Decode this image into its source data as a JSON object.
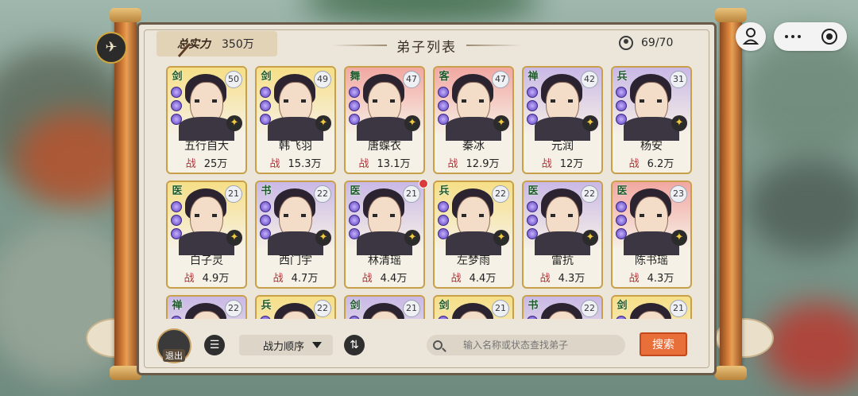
{
  "header": {
    "total_power_label": "总实力",
    "total_power_value": "350万",
    "title": "弟子列表",
    "disciple_count": "69/70"
  },
  "power_prefix": "战",
  "disciples": [
    {
      "type": "剑",
      "level": "50",
      "name": "五行自大",
      "power": "25万",
      "color": "#f6df86"
    },
    {
      "type": "剑",
      "level": "49",
      "name": "韩飞羽",
      "power": "15.3万",
      "color": "#f6df86"
    },
    {
      "type": "舞",
      "level": "47",
      "name": "唐蝶衣",
      "power": "13.1万",
      "color": "#f2a7a2"
    },
    {
      "type": "客",
      "level": "47",
      "name": "秦冰",
      "power": "12.9万",
      "color": "#f2a7a2"
    },
    {
      "type": "禅",
      "level": "42",
      "name": "元润",
      "power": "12万",
      "color": "#c9b8e6"
    },
    {
      "type": "兵",
      "level": "31",
      "name": "杨安",
      "power": "6.2万",
      "color": "#c9b8e6"
    },
    {
      "type": "医",
      "level": "21",
      "name": "白子灵",
      "power": "4.9万",
      "color": "#f6df86"
    },
    {
      "type": "书",
      "level": "22",
      "name": "西门宇",
      "power": "4.7万",
      "color": "#c9b8e6"
    },
    {
      "type": "医",
      "level": "21",
      "name": "林清瑶",
      "power": "4.4万",
      "color": "#c9b8e6"
    },
    {
      "type": "兵",
      "level": "22",
      "name": "左梦雨",
      "power": "4.4万",
      "color": "#f6df86"
    },
    {
      "type": "医",
      "level": "22",
      "name": "雷抗",
      "power": "4.3万",
      "color": "#c9b8e6"
    },
    {
      "type": "医",
      "level": "23",
      "name": "陈书瑶",
      "power": "4.3万",
      "color": "#f2a7a2"
    },
    {
      "type": "禅",
      "level": "22",
      "name": "",
      "power": "",
      "color": "#c9b8e6"
    },
    {
      "type": "兵",
      "level": "22",
      "name": "",
      "power": "",
      "color": "#f6df86"
    },
    {
      "type": "剑",
      "level": "21",
      "name": "",
      "power": "",
      "color": "#c9b8e6"
    },
    {
      "type": "剑",
      "level": "21",
      "name": "",
      "power": "",
      "color": "#f6df86"
    },
    {
      "type": "书",
      "level": "22",
      "name": "",
      "power": "",
      "color": "#c9b8e6"
    },
    {
      "type": "剑",
      "level": "21",
      "name": "",
      "power": "",
      "color": "#f6df86"
    }
  ],
  "bottom_bar": {
    "exit_label": "退出",
    "sort_label": "战力顺序",
    "search_placeholder": "输入名称或状态查找弟子",
    "search_button": "搜索"
  },
  "icons": {
    "left_badge": "✈"
  }
}
